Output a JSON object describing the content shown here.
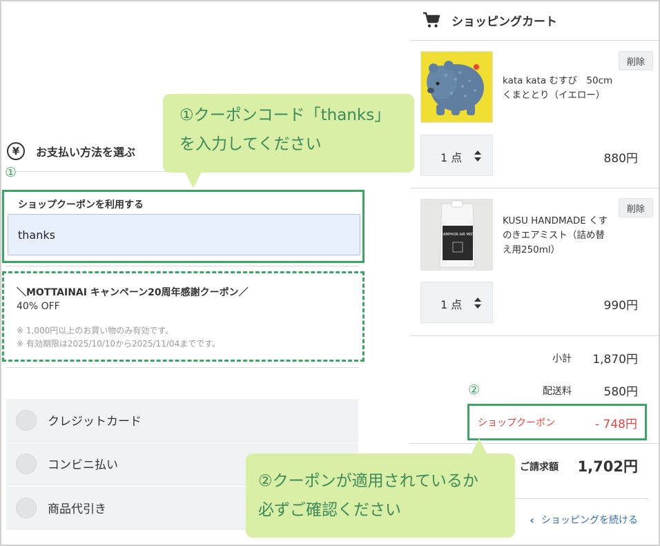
{
  "payment": {
    "heading_icon": "yen-icon",
    "heading": "お支払い方法を選ぶ",
    "marker_1": "①",
    "shop_coupon": {
      "label": "ショップクーポンを利用する",
      "value": "thanks"
    },
    "campaign": {
      "title": "＼MOTTAINAI キャンペーン20周年感謝クーポン／",
      "discount": "40% OFF",
      "notes": [
        "※ 1,000円以上のお買い物のみ有効です。",
        "※ 有効期限は2025/10/10から2025/11/04までです。"
      ]
    },
    "options": [
      {
        "label": "クレジットカード"
      },
      {
        "label": "コンビニ払い"
      },
      {
        "label": "商品代引き"
      }
    ]
  },
  "cart": {
    "title": "ショッピングカート",
    "icon": "cart-icon",
    "items": [
      {
        "name_line1": "kata kata むすび　50cm",
        "name_line2": "くまととり（イエロー）",
        "delete_label": "削除",
        "quantity": "1 点",
        "price": "880円"
      },
      {
        "name_line1": "KUSU HANDMADE くす",
        "name_line2": "のきエアミスト（詰め替",
        "name_line3": "え用250ml）",
        "delete_label": "削除",
        "quantity": "1 点",
        "price": "990円",
        "package_text": "CAMPHOR AIR MIST"
      }
    ],
    "summary": {
      "subtotal_label": "小計",
      "subtotal_value": "1,870円",
      "shipping_label": "配送料",
      "shipping_value": "580円",
      "marker_2": "②",
      "coupon_label": "ショップクーポン",
      "coupon_value": "- 748円",
      "total_label": "ご請求額",
      "total_value": "1,702円"
    },
    "continue_label": "ショッピングを続ける"
  },
  "callouts": {
    "first": {
      "line1": "①クーポンコード「thanks」",
      "line2": "を入力してください"
    },
    "second": {
      "line1": "②クーポンが適用されているか",
      "line2": "必ずご確認ください"
    }
  },
  "colors": {
    "highlight_green": "#3aa564",
    "callout_bg": "#d9efa6",
    "discount_red": "#e0443d",
    "link_blue": "#2f6fb6"
  }
}
